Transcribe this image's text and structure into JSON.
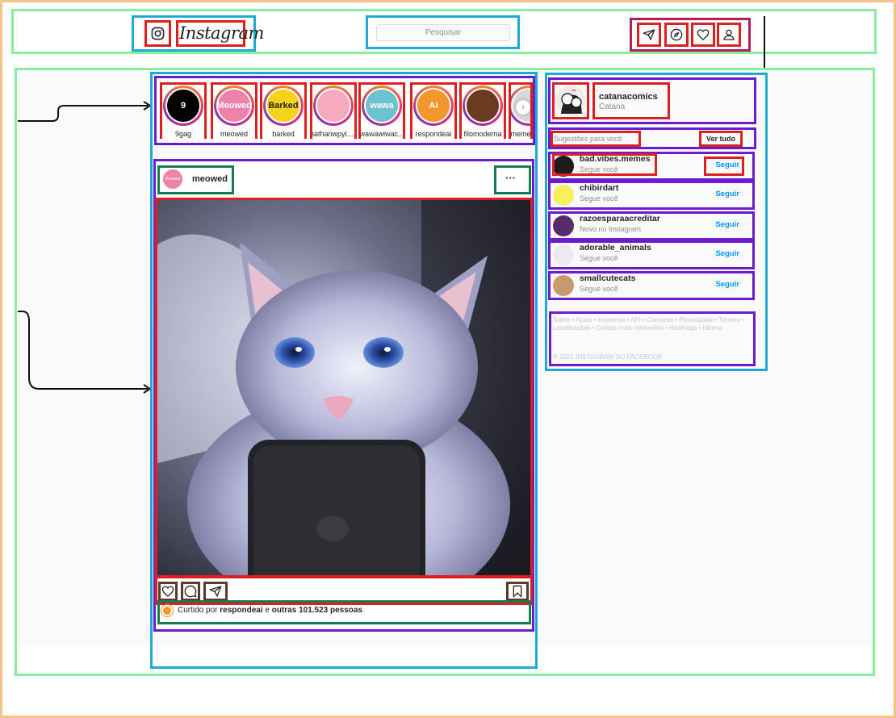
{
  "header": {
    "logo_text": "Instagram",
    "search_placeholder": "Pesquisar",
    "icons": [
      "instagram-glyph-icon",
      "send-icon",
      "explore-icon",
      "heart-icon",
      "profile-icon"
    ]
  },
  "stories": [
    {
      "name": "9gag",
      "avatar_text": "9",
      "color": "#000000"
    },
    {
      "name": "meowed",
      "avatar_text": "Meowed",
      "color": "#ee82a8"
    },
    {
      "name": "barked",
      "avatar_text": "Barked",
      "color": "#f7d21a"
    },
    {
      "name": "nathanwpyle...",
      "avatar_text": "",
      "color": "#f7a9c0"
    },
    {
      "name": "wawawiwac...",
      "avatar_text": "wawa",
      "color": "#6cc3cf"
    },
    {
      "name": "respondeai",
      "avatar_text": "Ai",
      "color": "#f2962d"
    },
    {
      "name": "filomoderna",
      "avatar_text": "",
      "color": "#6b3a22"
    },
    {
      "name": "meme",
      "avatar_text": "",
      "color": "#d7d7d7"
    }
  ],
  "post": {
    "author": "meowed",
    "author_avatar_text": "Meowed",
    "more_label": "···",
    "likes_prefix": "Curtido por",
    "likes_user": "respondeai",
    "likes_connector": "e",
    "likes_others": "outras 101.523 pessoas"
  },
  "sidebar": {
    "user": {
      "username": "catanacomics",
      "full_name": "Catana"
    },
    "suggestions_title": "Sugestões para você",
    "see_all": "Ver tudo",
    "suggestions": [
      {
        "username": "bad.vibes.memes",
        "subtitle": "Segue você",
        "action": "Seguir"
      },
      {
        "username": "chibirdart",
        "subtitle": "Segue você",
        "action": "Seguir"
      },
      {
        "username": "razoesparaacreditar",
        "subtitle": "Novo no Instagram",
        "action": "Seguir"
      },
      {
        "username": "adorable_animals",
        "subtitle": "Segue você",
        "action": "Seguir"
      },
      {
        "username": "smallcutecats",
        "subtitle": "Segue você",
        "action": "Seguir"
      }
    ],
    "footer_links": "Sobre • Ajuda • Imprensa • API • Carreiras • Privacidade • Termos • Localizações • Contas mais relevantes • Hashtags • Idioma",
    "copyright": "© 2021 INSTAGRAM DO FACEBOOK"
  },
  "colors": {
    "accent_link": "#0095f6",
    "muted_text": "#8e8e8e"
  }
}
